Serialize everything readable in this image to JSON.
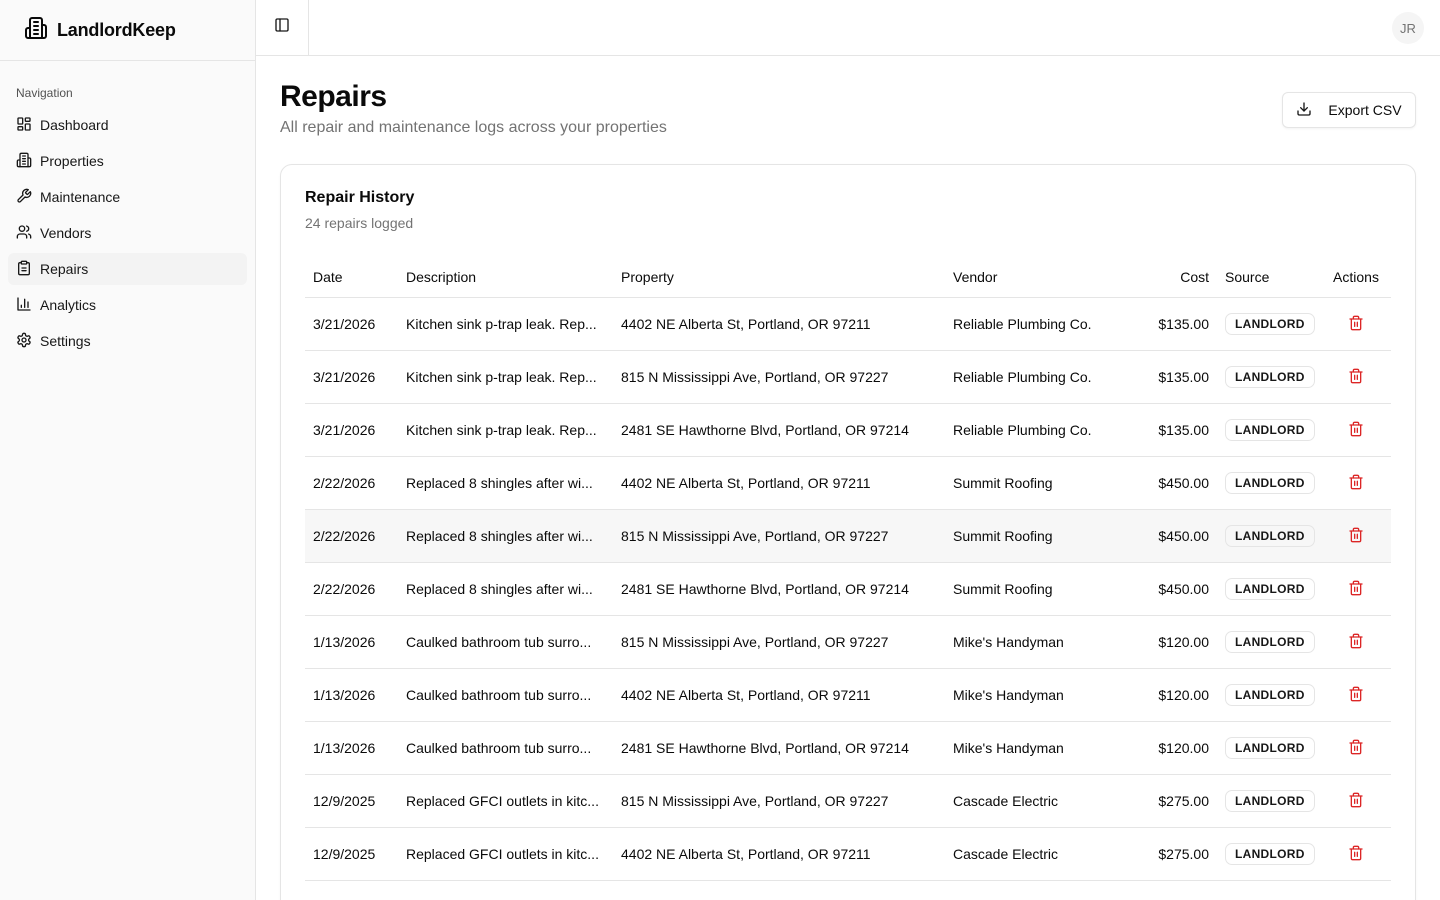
{
  "brand": {
    "name": "LandlordKeep"
  },
  "sidebar": {
    "group_label": "Navigation",
    "items": [
      {
        "label": "Dashboard",
        "icon": "dashboard-icon"
      },
      {
        "label": "Properties",
        "icon": "building-icon"
      },
      {
        "label": "Maintenance",
        "icon": "wrench-icon"
      },
      {
        "label": "Vendors",
        "icon": "users-icon"
      },
      {
        "label": "Repairs",
        "icon": "clipboard-icon",
        "active": true
      },
      {
        "label": "Analytics",
        "icon": "chart-icon"
      },
      {
        "label": "Settings",
        "icon": "gear-icon"
      }
    ]
  },
  "header": {
    "avatar_initials": "JR"
  },
  "page": {
    "title": "Repairs",
    "subtitle": "All repair and maintenance logs across your properties",
    "export_label": "Export CSV"
  },
  "card": {
    "title": "Repair History",
    "description": "24 repairs logged"
  },
  "table": {
    "headers": {
      "date": "Date",
      "description": "Description",
      "property": "Property",
      "vendor": "Vendor",
      "cost": "Cost",
      "source": "Source",
      "actions": "Actions"
    },
    "rows": [
      {
        "date": "3/21/2026",
        "description": "Kitchen sink p-trap leak. Rep...",
        "property": "4402 NE Alberta St, Portland, OR 97211",
        "vendor": "Reliable Plumbing Co.",
        "cost": "$135.00",
        "source": "LANDLORD"
      },
      {
        "date": "3/21/2026",
        "description": "Kitchen sink p-trap leak. Rep...",
        "property": "815 N Mississippi Ave, Portland, OR 97227",
        "vendor": "Reliable Plumbing Co.",
        "cost": "$135.00",
        "source": "LANDLORD"
      },
      {
        "date": "3/21/2026",
        "description": "Kitchen sink p-trap leak. Rep...",
        "property": "2481 SE Hawthorne Blvd, Portland, OR 97214",
        "vendor": "Reliable Plumbing Co.",
        "cost": "$135.00",
        "source": "LANDLORD"
      },
      {
        "date": "2/22/2026",
        "description": "Replaced 8 shingles after wi...",
        "property": "4402 NE Alberta St, Portland, OR 97211",
        "vendor": "Summit Roofing",
        "cost": "$450.00",
        "source": "LANDLORD"
      },
      {
        "date": "2/22/2026",
        "description": "Replaced 8 shingles after wi...",
        "property": "815 N Mississippi Ave, Portland, OR 97227",
        "vendor": "Summit Roofing",
        "cost": "$450.00",
        "source": "LANDLORD",
        "hover": true
      },
      {
        "date": "2/22/2026",
        "description": "Replaced 8 shingles after wi...",
        "property": "2481 SE Hawthorne Blvd, Portland, OR 97214",
        "vendor": "Summit Roofing",
        "cost": "$450.00",
        "source": "LANDLORD"
      },
      {
        "date": "1/13/2026",
        "description": "Caulked bathroom tub surro...",
        "property": "815 N Mississippi Ave, Portland, OR 97227",
        "vendor": "Mike's Handyman",
        "cost": "$120.00",
        "source": "LANDLORD"
      },
      {
        "date": "1/13/2026",
        "description": "Caulked bathroom tub surro...",
        "property": "4402 NE Alberta St, Portland, OR 97211",
        "vendor": "Mike's Handyman",
        "cost": "$120.00",
        "source": "LANDLORD"
      },
      {
        "date": "1/13/2026",
        "description": "Caulked bathroom tub surro...",
        "property": "2481 SE Hawthorne Blvd, Portland, OR 97214",
        "vendor": "Mike's Handyman",
        "cost": "$120.00",
        "source": "LANDLORD"
      },
      {
        "date": "12/9/2025",
        "description": "Replaced GFCI outlets in kitc...",
        "property": "815 N Mississippi Ave, Portland, OR 97227",
        "vendor": "Cascade Electric",
        "cost": "$275.00",
        "source": "LANDLORD"
      },
      {
        "date": "12/9/2025",
        "description": "Replaced GFCI outlets in kitc...",
        "property": "4402 NE Alberta St, Portland, OR 97211",
        "vendor": "Cascade Electric",
        "cost": "$275.00",
        "source": "LANDLORD"
      }
    ]
  },
  "colors": {
    "delete": "#dc2626",
    "border": "#e5e5e5",
    "muted_text": "#737373",
    "sidebar_bg": "#fafafa"
  }
}
